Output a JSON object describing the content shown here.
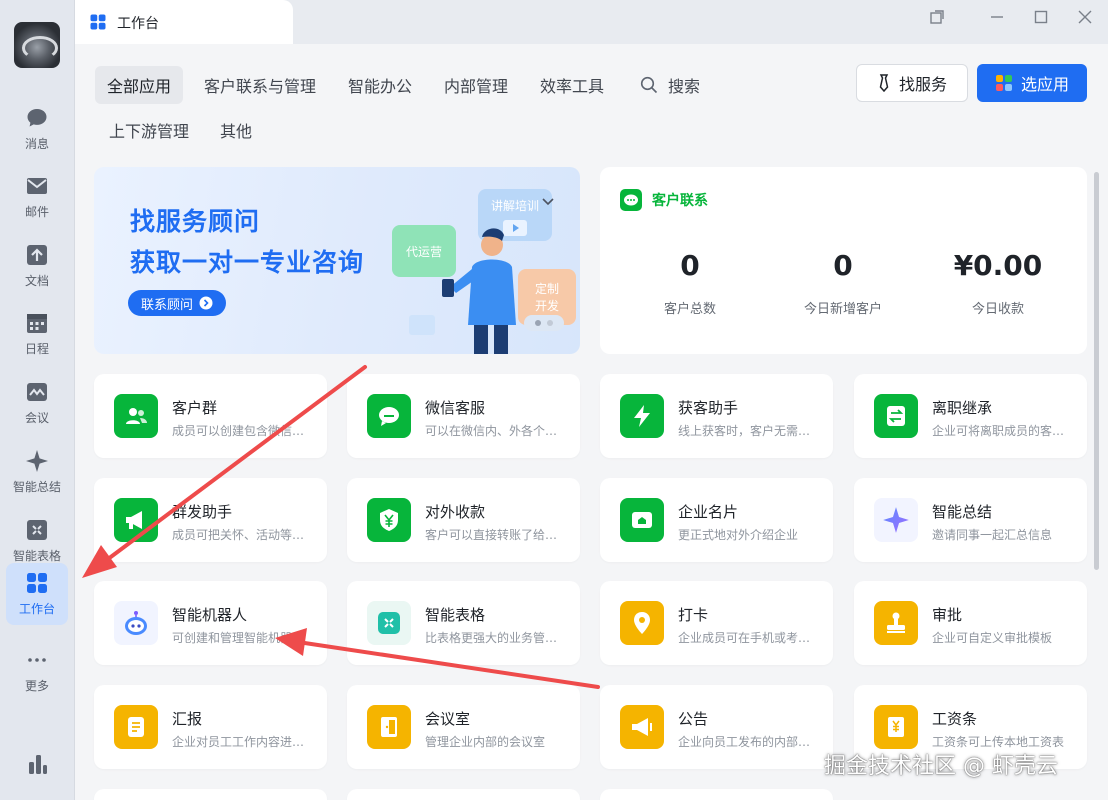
{
  "window": {
    "tab_title": "工作台"
  },
  "rail": {
    "items": [
      {
        "label": "消息",
        "icon": "chat-bubble-icon"
      },
      {
        "label": "邮件",
        "icon": "mail-icon"
      },
      {
        "label": "文档",
        "icon": "doc-icon"
      },
      {
        "label": "日程",
        "icon": "calendar-icon"
      },
      {
        "label": "会议",
        "icon": "meeting-icon"
      },
      {
        "label": "智能总结",
        "icon": "sparkle-icon"
      },
      {
        "label": "智能表格",
        "icon": "smart-table-icon"
      },
      {
        "label": "工作台",
        "icon": "grid-apps-icon",
        "active": true
      },
      {
        "label": "更多",
        "icon": "more-dots-icon"
      }
    ]
  },
  "nav": {
    "tabs": [
      "全部应用",
      "客户联系与管理",
      "智能办公",
      "内部管理",
      "效率工具"
    ],
    "search_label": "搜索",
    "row2": [
      "上下游管理",
      "其他"
    ],
    "find_service": "找服务",
    "select_app": "选应用"
  },
  "banner": {
    "line1": "找服务顾问",
    "line2": "获取一对一专业咨询",
    "button": "联系顾问",
    "chip_train": "讲解培训",
    "chip_ops": "代运营",
    "chip_custom_1": "定制",
    "chip_custom_2": "开发"
  },
  "stats": {
    "title": "客户联系",
    "items": [
      {
        "value": "0",
        "label": "客户总数"
      },
      {
        "value": "0",
        "label": "今日新增客户"
      },
      {
        "value": "¥0.00",
        "label": "今日收款"
      }
    ]
  },
  "apps": [
    {
      "name": "客户群",
      "desc": "成员可以创建包含微信用户的客户群",
      "icon": "customer-group-icon",
      "color": "green"
    },
    {
      "name": "微信客服",
      "desc": "可以在微信内、外各个场景中接入",
      "icon": "wechat-service-icon",
      "color": "green"
    },
    {
      "name": "获客助手",
      "desc": "线上获客时，客户无需添加即可沟通",
      "icon": "lightning-icon",
      "color": "green"
    },
    {
      "name": "离职继承",
      "desc": "企业可将离职成员的客户分配",
      "icon": "transfer-icon",
      "color": "green"
    },
    {
      "name": "群发助手",
      "desc": "成员可把关怀、活动等消息群发",
      "icon": "megaphone-icon",
      "color": "green"
    },
    {
      "name": "对外收款",
      "desc": "客户可以直接转账了给成员",
      "icon": "yuan-shield-icon",
      "color": "green"
    },
    {
      "name": "企业名片",
      "desc": "更正式地对外介绍企业",
      "icon": "business-card-icon",
      "color": "green"
    },
    {
      "name": "智能总结",
      "desc": "邀请同事一起汇总信息",
      "icon": "sparkle-icon",
      "color": "none"
    },
    {
      "name": "智能机器人",
      "desc": "可创建和管理智能机器人",
      "icon": "robot-icon",
      "color": "none"
    },
    {
      "name": "智能表格",
      "desc": "比表格更强大的业务管理工具",
      "icon": "smart-table-icon",
      "color": "none"
    },
    {
      "name": "打卡",
      "desc": "企业成员可在手机或考勤机上打卡",
      "icon": "location-pin-icon",
      "color": "yellow"
    },
    {
      "name": "审批",
      "desc": "企业可自定义审批模板",
      "icon": "stamp-icon",
      "color": "yellow"
    },
    {
      "name": "汇报",
      "desc": "企业对员工工作内容进行汇报",
      "icon": "report-icon",
      "color": "yellow"
    },
    {
      "name": "会议室",
      "desc": "管理企业内部的会议室",
      "icon": "door-icon",
      "color": "yellow"
    },
    {
      "name": "公告",
      "desc": "企业向员工发布的内部公告",
      "icon": "announce-icon",
      "color": "yellow"
    },
    {
      "name": "工资条",
      "desc": "工资条可上传本地工资表",
      "icon": "payslip-icon",
      "color": "yellow"
    }
  ],
  "watermark": "掘金技术社区 @ 虾壳云",
  "colors": {
    "accent": "#1f6df2",
    "green": "#07b53b",
    "yellow": "#f5b400",
    "arrow": "#ee4b4b"
  }
}
